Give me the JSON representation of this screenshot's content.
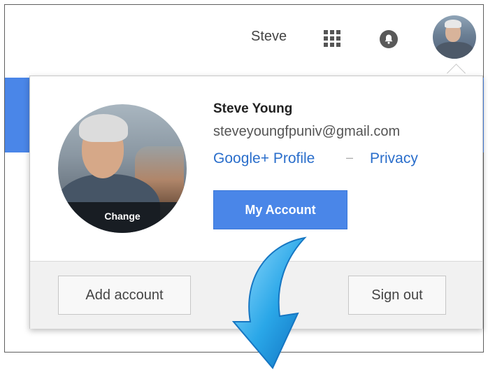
{
  "topbar": {
    "user_short_name": "Steve",
    "apps_icon": "apps-grid-icon",
    "notifications_icon": "bell-icon"
  },
  "account_card": {
    "avatar_change_label": "Change",
    "name": "Steve Young",
    "email": "steveyoungfpuniv@gmail.com",
    "profile_link": "Google+ Profile",
    "link_separator": "–",
    "privacy_link": "Privacy",
    "my_account_button": "My Account",
    "add_account_button": "Add account",
    "sign_out_button": "Sign out"
  },
  "colors": {
    "accent_blue": "#4a86e8",
    "link_blue": "#2a6ecb",
    "arrow_blue": "#2aa7e8"
  },
  "annotation": {
    "icon": "curved-arrow-down-icon"
  }
}
